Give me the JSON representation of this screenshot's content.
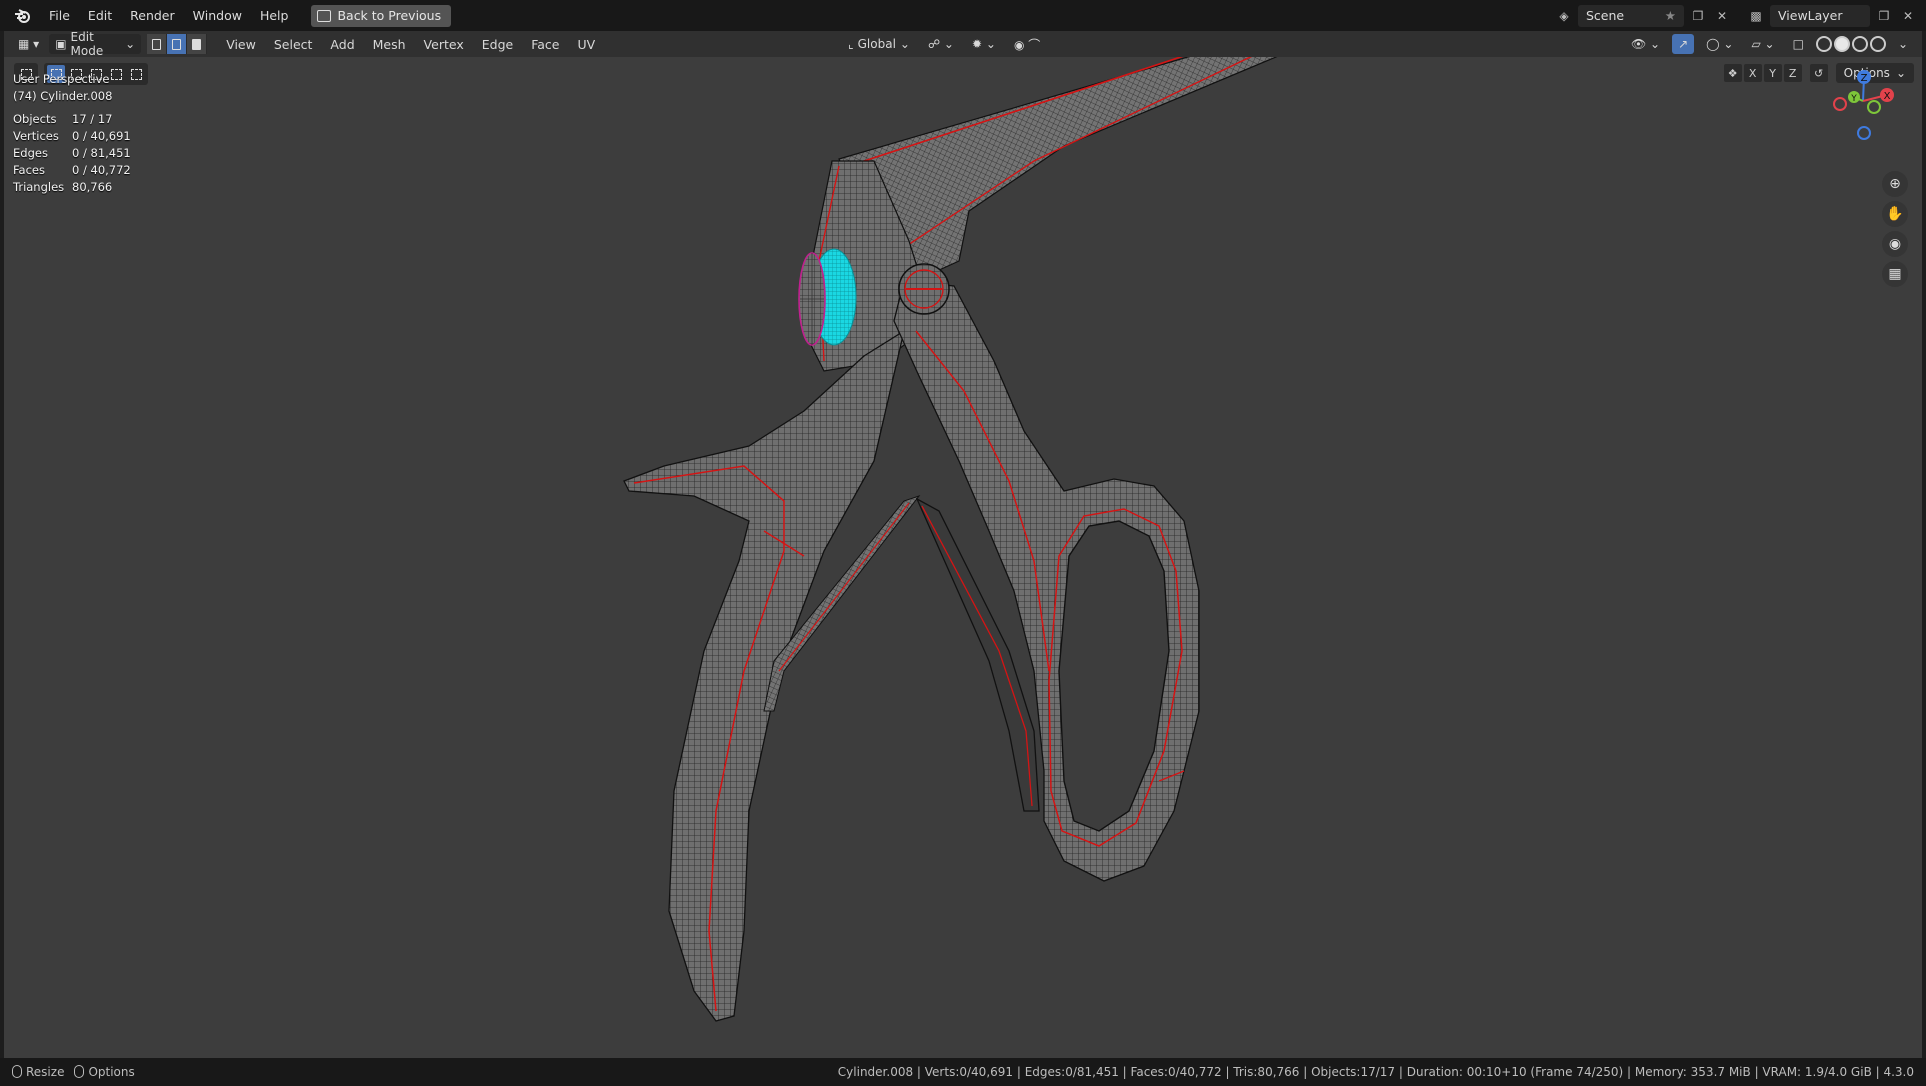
{
  "menubar": {
    "items": [
      "File",
      "Edit",
      "Render",
      "Window",
      "Help"
    ],
    "back_button": "Back to Previous",
    "scene": "Scene",
    "view_layer": "ViewLayer"
  },
  "viewport_header": {
    "mode": "Edit Mode",
    "menus": [
      "View",
      "Select",
      "Add",
      "Mesh",
      "Vertex",
      "Edge",
      "Face",
      "UV"
    ],
    "orientation": "Global",
    "options": "Options",
    "axes": [
      "X",
      "Y",
      "Z"
    ]
  },
  "overlay": {
    "perspective": "User Perspective",
    "object": "(74) Cylinder.008",
    "stats": [
      {
        "label": "Objects",
        "value": "17 / 17"
      },
      {
        "label": "Vertices",
        "value": "0 / 40,691"
      },
      {
        "label": "Edges",
        "value": "0 / 81,451"
      },
      {
        "label": "Faces",
        "value": "0 / 40,772"
      },
      {
        "label": "Triangles",
        "value": "80,766"
      }
    ]
  },
  "gizmo": {
    "z": "Z",
    "y": "Y",
    "x": "X"
  },
  "statusbar": {
    "resize": "Resize",
    "options": "Options",
    "info": "Cylinder.008 | Verts:0/40,691 | Edges:0/81,451 | Faces:0/40,772 | Tris:80,766 | Objects:17/17 | Duration: 00:10+10 (Frame 74/250) | Memory: 353.7 MiB | VRAM: 1.9/4.0 GiB | 4.3.0"
  },
  "colors": {
    "viewport_bg": "#3d3d3d",
    "mesh": "#6e6e6e",
    "seam": "#d41414",
    "selection": "#18d6e0",
    "active_tab": "#4772b3"
  },
  "icons": [
    "blender-logo-icon",
    "back-icon",
    "scene-icon",
    "view-layer-icon",
    "editor-type-icon",
    "select-box-icon",
    "gizmo-icon",
    "zoom-icon",
    "pan-hand-icon",
    "camera-icon",
    "grid-icon"
  ]
}
